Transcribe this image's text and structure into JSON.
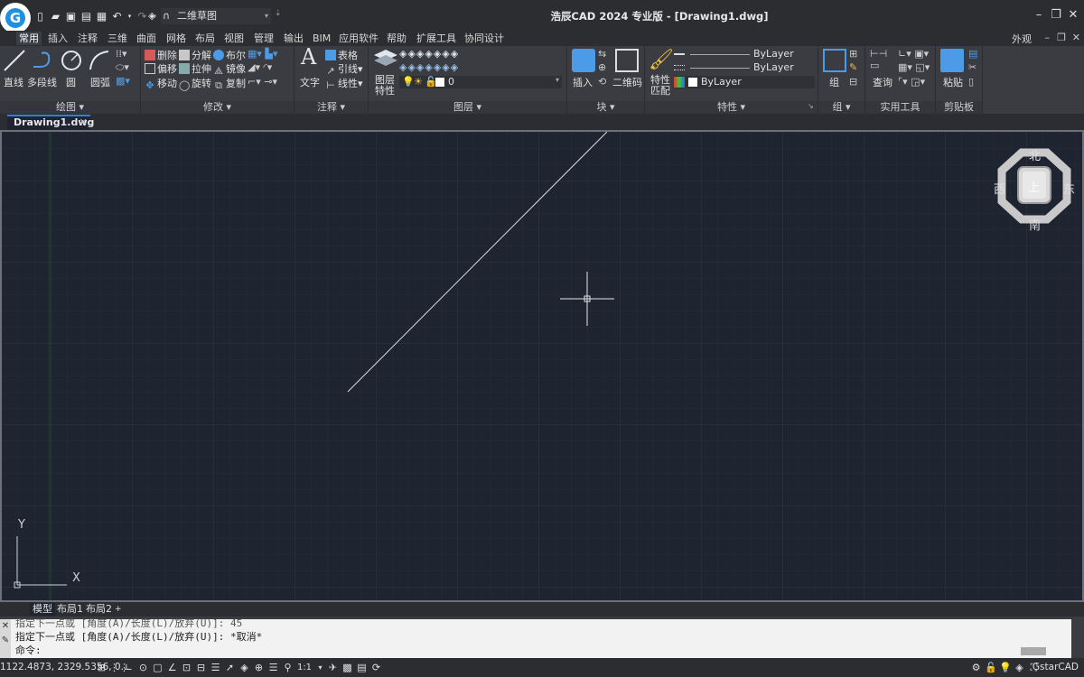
{
  "app": {
    "title": "浩辰CAD 2024 专业版 - [Drawing1.dwg]",
    "workspace": "二维草图",
    "appearance": "外观"
  },
  "menu_tabs": [
    "常用",
    "插入",
    "注释",
    "三维",
    "曲面",
    "网格",
    "布局",
    "视图",
    "管理",
    "输出",
    "BIM",
    "应用软件",
    "帮助",
    "扩展工具",
    "协同设计"
  ],
  "ribbon": {
    "draw": {
      "title": "绘图",
      "line": "直线",
      "polyline": "多段线",
      "circle": "圆",
      "arc": "圆弧"
    },
    "modify": {
      "title": "修改",
      "erase": "删除",
      "explode": "分解",
      "boolean": "布尔",
      "offset": "偏移",
      "stretch": "拉伸",
      "mirror": "镜像",
      "move": "移动",
      "rotate": "旋转",
      "copy": "复制"
    },
    "annotate": {
      "title": "注释",
      "text": "文字",
      "table": "表格",
      "leader": "引线",
      "linetype": "线性"
    },
    "layers": {
      "title": "图层",
      "layer_props": "图层\n特性",
      "layer_props_line1": "图层",
      "layer_props_line2": "特性",
      "current_layer": "0"
    },
    "block": {
      "title": "块",
      "insert": "插入",
      "qrcode": "二维码"
    },
    "properties": {
      "title": "特性",
      "match_line1": "特性",
      "match_line2": "匹配",
      "linetype": "ByLayer",
      "lineweight": "ByLayer",
      "color": "ByLayer"
    },
    "group": {
      "title": "组",
      "group": "组"
    },
    "utilities": {
      "title": "实用工具",
      "query": "查询"
    },
    "clipboard": {
      "title": "剪贴板",
      "paste": "粘贴"
    }
  },
  "doc_tab": {
    "name": "Drawing1.dwg"
  },
  "viewcube": {
    "north": "北",
    "south": "南",
    "east": "东",
    "west": "西",
    "top": "上"
  },
  "ucs": {
    "x": "X",
    "y": "Y"
  },
  "layout_tabs": [
    "模型",
    "布局1",
    "布局2",
    "+"
  ],
  "command": {
    "line1": "指定下一点或 [角度(A)/长度(L)/放弃(U)]: 45",
    "line2": "指定下一点或 [角度(A)/长度(L)/放弃(U)]: *取消*",
    "prompt": "命令:"
  },
  "status": {
    "coords": "1122.4873, 2329.5356, 0...",
    "scale": "1:1",
    "brand": "GstarCAD"
  }
}
